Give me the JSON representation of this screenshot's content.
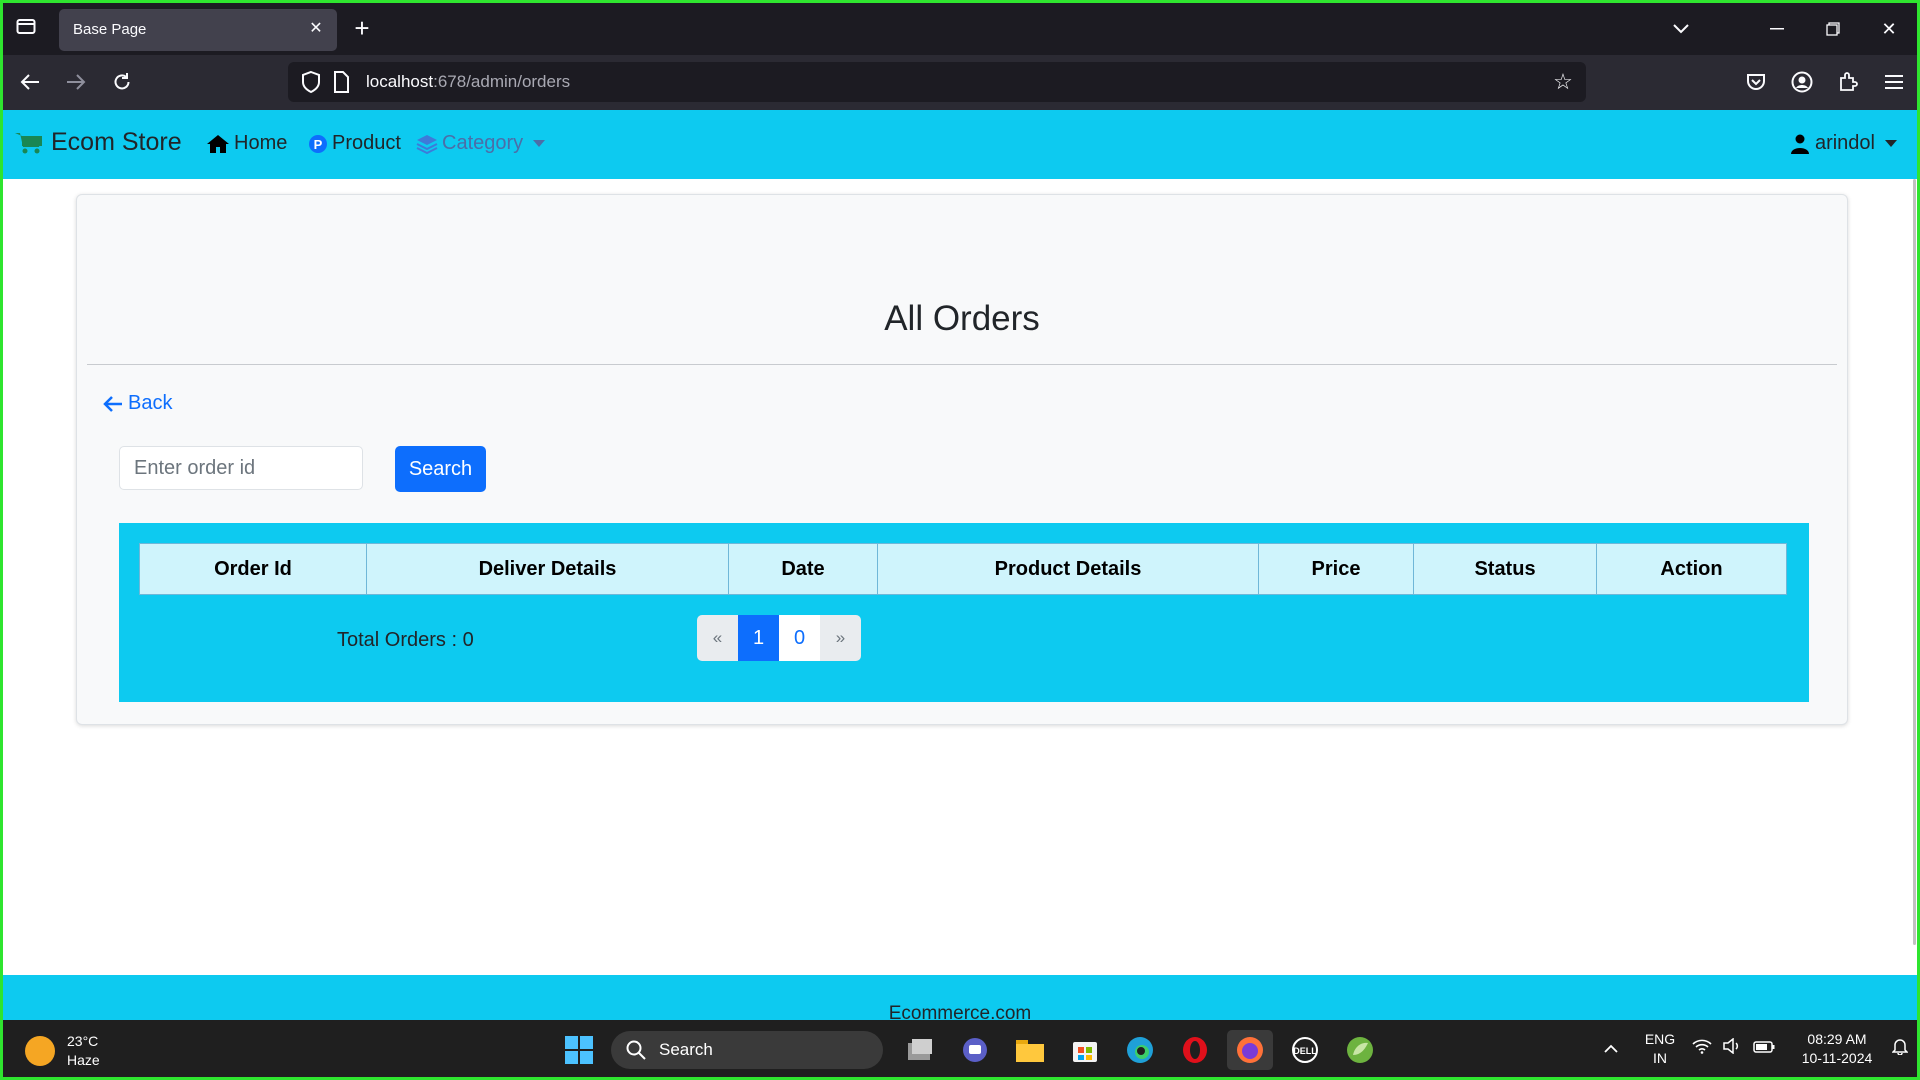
{
  "browser": {
    "tab_title": "Base Page",
    "url_host": "localhost",
    "url_path": ":678/admin/orders"
  },
  "site": {
    "brand": "Ecom Store",
    "nav": {
      "home": "Home",
      "product": "Product",
      "category": "Category"
    },
    "user": "arindol",
    "accent": "#0dcaf0",
    "primary": "#0d6efd"
  },
  "page": {
    "title": "All Orders",
    "back": "Back",
    "search_placeholder": "Enter order id",
    "search_button": "Search",
    "table_headers": [
      "Order Id",
      "Deliver Details",
      "Date",
      "Product Details",
      "Price",
      "Status",
      "Action"
    ],
    "total_orders": "Total Orders : 0",
    "pagination": {
      "prev": "«",
      "pages": [
        "1",
        "0"
      ],
      "next": "»"
    }
  },
  "footer": {
    "text": "Ecommerce.com"
  },
  "taskbar": {
    "temperature": "23°C",
    "weather": "Haze",
    "search": "Search",
    "lang": "ENG",
    "region": "IN",
    "time": "08:29 AM",
    "date": "10-11-2024"
  }
}
